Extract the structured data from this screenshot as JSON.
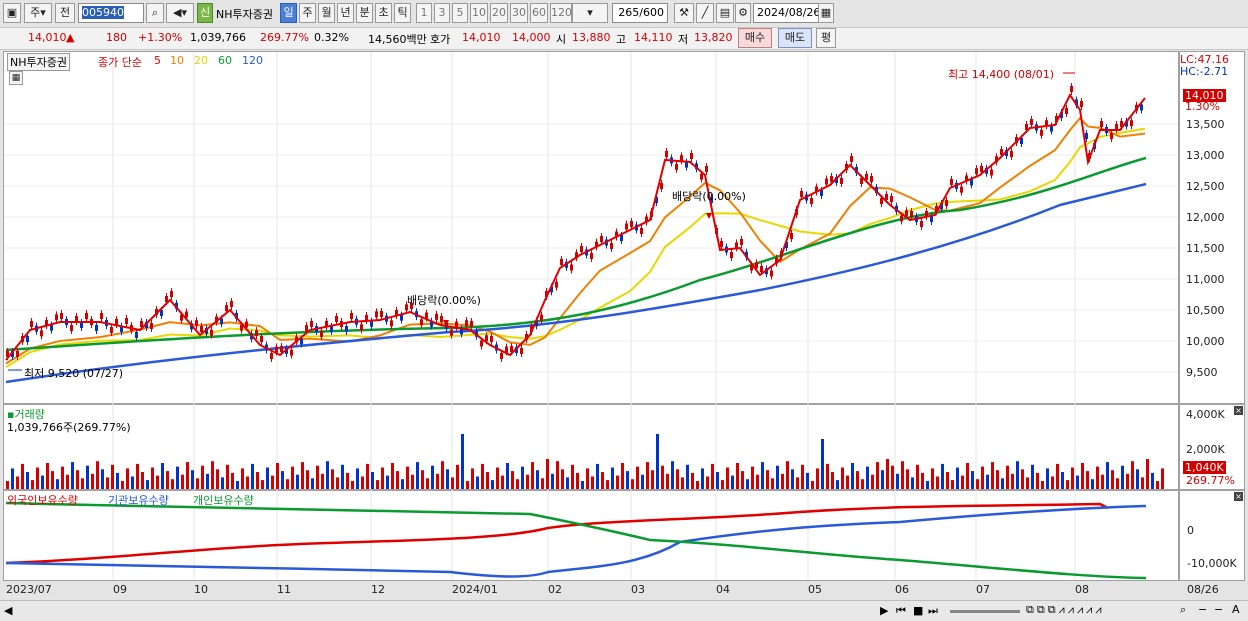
{
  "toolbar": {
    "mode": "주",
    "prev": "전",
    "code": "005940",
    "badge": "신",
    "name": "NH투자증권",
    "periods": [
      "일",
      "주",
      "월",
      "년",
      "분",
      "초",
      "틱"
    ],
    "ticks": [
      "1",
      "3",
      "5",
      "10",
      "20",
      "30",
      "60",
      "120"
    ],
    "count": "265",
    "total": "/600",
    "date": "2024/08/26"
  },
  "quote": {
    "price": "14,010",
    "arrow": "▲",
    "change": "180",
    "rate": "+1.30%",
    "volume": "1,039,766",
    "vol_rate": "269.77%",
    "turnover": "0.32%",
    "amount": "14,560백만",
    "ask_label": "호가",
    "ask1": "14,010",
    "ask2": "14,000",
    "open_label": "시",
    "open": "13,880",
    "high_label": "고",
    "high": "14,110",
    "low_label": "저",
    "low": "13,820",
    "buy": "매수",
    "sell": "매도",
    "pyeong": "평"
  },
  "price_pane": {
    "name": "NH투자증권",
    "legend_prefix": "종가 단순",
    "ma": [
      {
        "label": "5",
        "color": "#e00000"
      },
      {
        "label": "10",
        "color": "#f08000"
      },
      {
        "label": "20",
        "color": "#e8d800"
      },
      {
        "label": "60",
        "color": "#0a9a30"
      },
      {
        "label": "120",
        "color": "#2a5ad8"
      }
    ],
    "high_note": "최고 14,400 (08/01)",
    "low_note": "최저 9,520 (07/27)",
    "div1": "배당락(0.00%)",
    "div2": "배당락(0.00%)",
    "lc": "LC:47.16",
    "hc": "HC:-2.71",
    "last_tag": "14,010",
    "last_rate": "1.30%",
    "y_ticks": [
      "13,500",
      "13,000",
      "12,500",
      "12,000",
      "11,500",
      "11,000",
      "10,500",
      "10,000",
      "9,500"
    ]
  },
  "volume_pane": {
    "title": "거래량",
    "summary": "1,039,766주(269.77%)",
    "y_ticks": [
      "4,000K",
      "2,000K"
    ],
    "last_tag": "1,040K",
    "last_rate": "269.77%"
  },
  "holding_pane": {
    "legend": [
      "외국인보유수량",
      "기관보유수량",
      "개인보유수량"
    ],
    "colors": [
      "#e00000",
      "#2a5ad8",
      "#0a9a30"
    ],
    "y_ticks": [
      "0",
      "-10,000K"
    ]
  },
  "x_labels": [
    "2023/07",
    "09",
    "10",
    "11",
    "12",
    "2024/01",
    "02",
    "03",
    "04",
    "05",
    "06",
    "07",
    "08",
    "08/26"
  ],
  "colors": {
    "up": "#d40000",
    "down": "#0033cc",
    "accent": "#4a7fd8"
  }
}
